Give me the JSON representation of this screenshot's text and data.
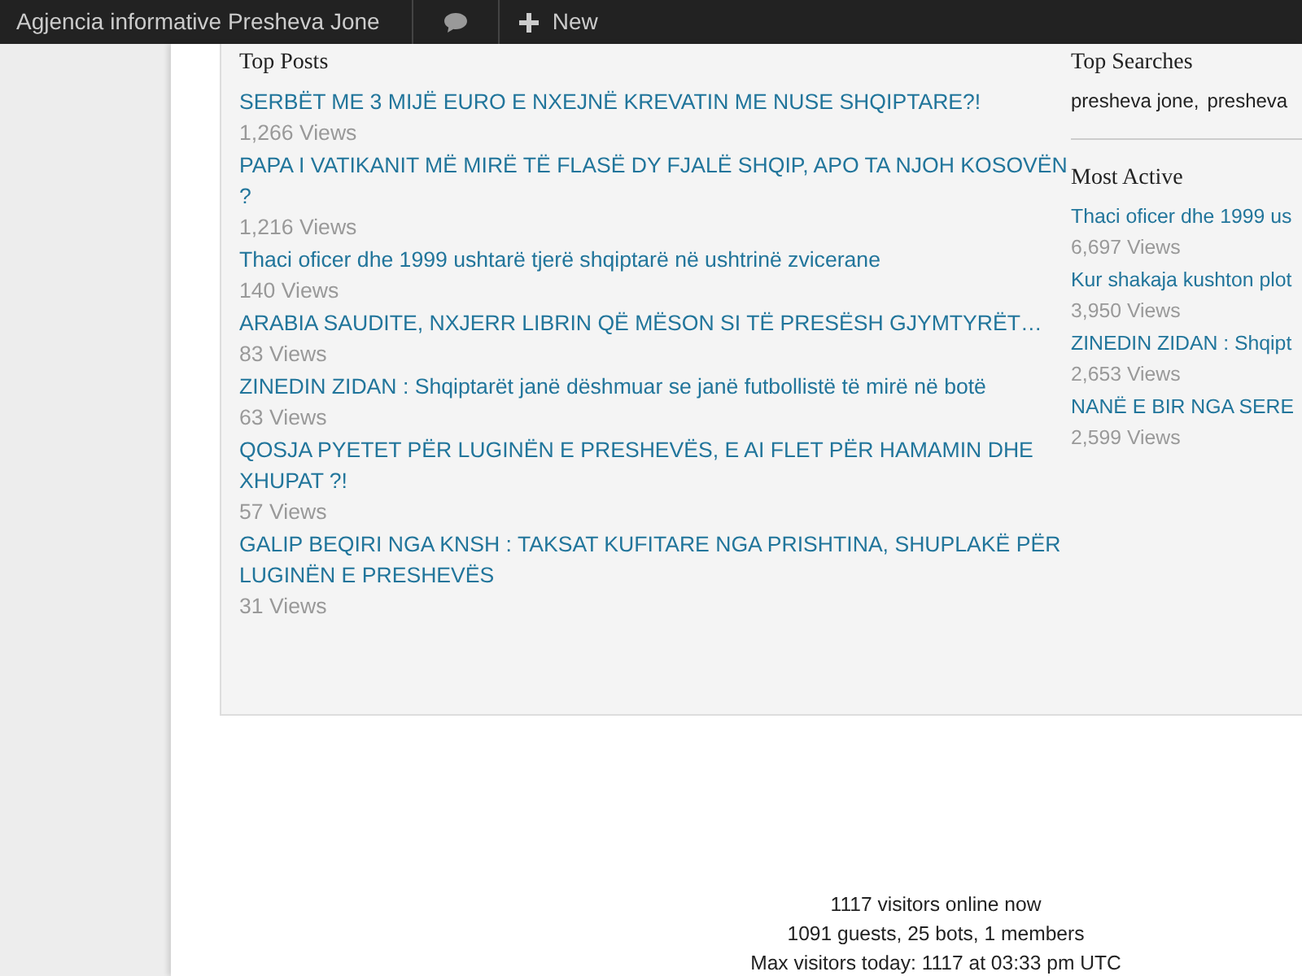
{
  "admin_bar": {
    "site_title": "Agjencia informative Presheva Jone",
    "new_label": "New"
  },
  "top_posts": {
    "title": "Top Posts",
    "posts": [
      {
        "title": "SERBËT ME 3 MIJË EURO E NXEJNË KREVATIN ME NUSE SHQIPTARE?!",
        "views": "1,266 Views"
      },
      {
        "title": "PAPA I VATIKANIT MË MIRË TË FLASË DY FJALË SHQIP, APO TA NJOH KOSOVËN ?",
        "views": "1,216 Views"
      },
      {
        "title": "Thaci oficer dhe 1999 ushtarë tjerë shqiptarë në ushtrinë zvicerane",
        "views": "140 Views"
      },
      {
        "title": "ARABIA SAUDITE, NXJERR LIBRIN QË MËSON SI TË PRESËSH GJYMTYRËT…",
        "views": "83 Views"
      },
      {
        "title": "ZINEDIN ZIDAN : Shqiptarët janë dëshmuar se janë futbollistë të mirë në botë",
        "views": "63 Views"
      },
      {
        "title": "QOSJA PYETET PËR LUGINËN E PRESHEVËS, E AI FLET PËR HAMAMIN DHE XHUPAT ?!",
        "views": "57 Views"
      },
      {
        "title": "GALIP BEQIRI NGA KNSH : TAKSAT KUFITARE NGA PRISHTINA, SHUPLAKË PËR LUGINËN E PRESHEVËS",
        "views": "31 Views"
      }
    ]
  },
  "top_searches": {
    "title": "Top Searches",
    "terms": [
      "presheva jone,",
      "presheva"
    ]
  },
  "most_active": {
    "title": "Most Active",
    "posts": [
      {
        "title": "Thaci oficer dhe 1999 us",
        "views": "6,697 Views"
      },
      {
        "title": "Kur shakaja kushton plot",
        "views": "3,950 Views"
      },
      {
        "title": "ZINEDIN ZIDAN : Shqipt",
        "views": "2,653 Views"
      },
      {
        "title": "NANË E BIR NGA SERE",
        "views": "2,599 Views"
      }
    ]
  },
  "visitors": [
    "1117 visitors online now",
    "1091 guests, 25 bots, 1 members",
    "Max visitors today: 1117 at 03:33 pm UTC"
  ]
}
